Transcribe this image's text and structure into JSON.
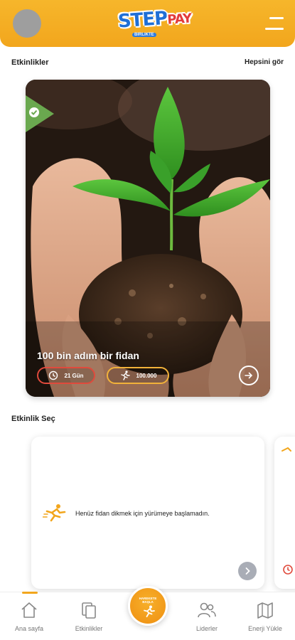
{
  "header": {
    "logo_text": "STEP",
    "logo_text2": "PAY",
    "logo_sub": "BIRLIKTE"
  },
  "activities": {
    "title": "Etkinlikler",
    "see_all": "Hepsini gör",
    "featured": {
      "title": "100 bin adım bir fidan",
      "days": "21 Gün",
      "steps": "100.000",
      "completed": true
    }
  },
  "select": {
    "title": "Etkinlik Seç",
    "empty_text": "Henüz fidan dikmek için yürümeye başlamadın."
  },
  "fab": {
    "label_line1": "HAREKETE",
    "label_line2": "BAŞLA"
  },
  "nav": {
    "items": [
      {
        "label": "Ana sayfa",
        "icon": "home-icon",
        "active": true
      },
      {
        "label": "Etkinlikler",
        "icon": "copy-icon",
        "active": false
      },
      {
        "label": "Liderler",
        "icon": "users-icon",
        "active": false
      },
      {
        "label": "Enerji Yükle",
        "icon": "map-icon",
        "active": false
      }
    ]
  },
  "colors": {
    "brand": "#f2a61d",
    "days_border": "#e04a3c",
    "steps_border": "#f2b23a",
    "nav_text": "#777777"
  }
}
